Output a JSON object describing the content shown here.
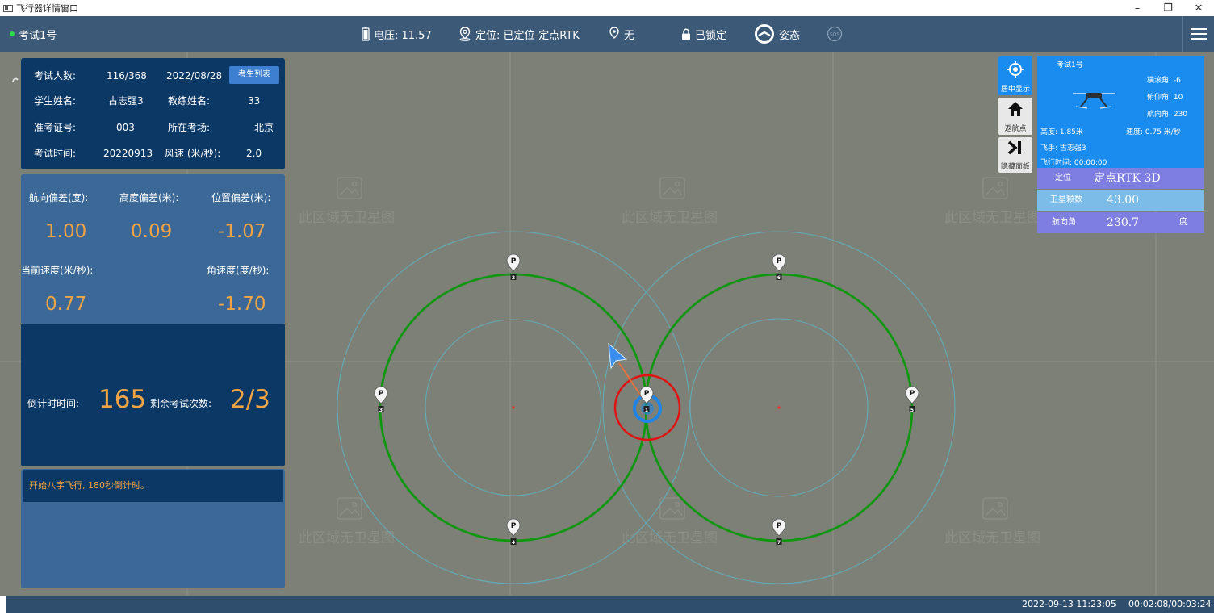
{
  "window": {
    "title": "飞行器详情窗口",
    "minimize_glyph": "–",
    "restore_glyph": "❐",
    "close_glyph": "✕"
  },
  "topbar": {
    "drone_name": "考试1号",
    "voltage": "电压: 11.57",
    "positioning": "定位: 已定位-定点RTK",
    "signal": "无",
    "lock": "已锁定",
    "attitude": "姿态",
    "sos": "SOS",
    "status_color": "#2bdc4a"
  },
  "exam_info": {
    "count_label": "考试人数:",
    "count_value": "116/368",
    "date": "2022/08/28",
    "student_list_button": "考生列表",
    "student_label": "学生姓名:",
    "student_value": "古志强3",
    "coach_label": "教练姓名:",
    "coach_value": "33",
    "ticket_label": "准考证号:",
    "ticket_value": "003",
    "site_label": "所在考场:",
    "site_value": "北京",
    "time_label": "考试时间:",
    "time_value": "20220913",
    "wind_label": "风速 (米/秒):",
    "wind_value": "2.0"
  },
  "deviation": {
    "heading_label": "航向偏差(度):",
    "heading_value": "1.00",
    "height_label": "高度偏差(米):",
    "height_value": "0.09",
    "position_label": "位置偏差(米):",
    "position_value": "-1.07",
    "speed_label": "当前速度(米/秒):",
    "speed_value": "0.77",
    "angular_label": "角速度(度/秒):",
    "angular_value": "-1.70"
  },
  "countdown": {
    "timer_label": "倒计时时间:",
    "timer_value": "165",
    "remaining_label": "剩余考试次数:",
    "remaining_value": "2/3"
  },
  "message": {
    "text": "开始八字飞行, 180秒倒计时。"
  },
  "map": {
    "watermark": "此区域无卫星图",
    "waypoint_letter": "P",
    "waypoints": [
      {
        "id": "wp-top-left",
        "tag": "2"
      },
      {
        "id": "wp-top-right",
        "tag": "6"
      },
      {
        "id": "wp-left",
        "tag": "3"
      },
      {
        "id": "wp-center",
        "tag": "1"
      },
      {
        "id": "wp-right",
        "tag": "5"
      },
      {
        "id": "wp-bottom-left",
        "tag": "4"
      },
      {
        "id": "wp-bottom-right",
        "tag": "7"
      }
    ]
  },
  "side_buttons": {
    "center": "居中显示",
    "home": "返航点",
    "hide": "隐藏面板"
  },
  "status_panel": {
    "name": "考试1号",
    "roll": "横滚角: -6",
    "pitch": "俯仰角: 10",
    "yaw": "航向角: 230",
    "height": "高度: 1.85米",
    "speed": "速度: 0.75 米/秒",
    "pilot": "飞手: 古志强3",
    "flight_time": "飞行时间: 00:00:00",
    "positioning_label": "定位",
    "positioning_value": "定点RTK 3D",
    "satellites_label": "卫星颗数",
    "satellites_value": "43.00",
    "heading_label": "航向角",
    "heading_value": "230.7",
    "heading_unit": "度"
  },
  "bottombar": {
    "datetime": "2022-09-13 11:23:05",
    "elapsed": "00:02:08/00:03:24"
  }
}
